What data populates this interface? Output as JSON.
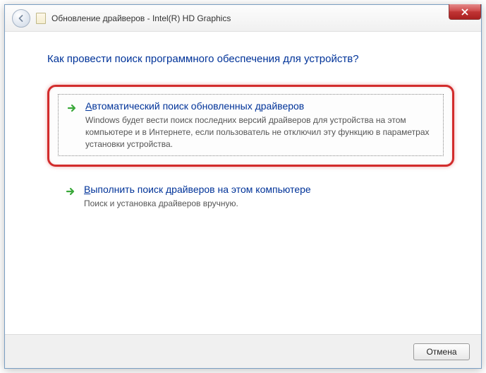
{
  "window": {
    "title": "Обновление драйверов - Intel(R) HD Graphics"
  },
  "content": {
    "heading": "Как провести поиск программного обеспечения для устройств?",
    "options": [
      {
        "first_letter": "А",
        "title_rest": "втоматический поиск обновленных драйверов",
        "description": "Windows будет вести поиск последних версий драйверов для устройства на этом компьютере и в Интернете, если пользователь не отключил эту функцию в параметрах установки устройства."
      },
      {
        "first_letter": "В",
        "title_rest": "ыполнить поиск драйверов на этом компьютере",
        "description": "Поиск и установка драйверов вручную."
      }
    ]
  },
  "footer": {
    "cancel_label": "Отмена"
  }
}
